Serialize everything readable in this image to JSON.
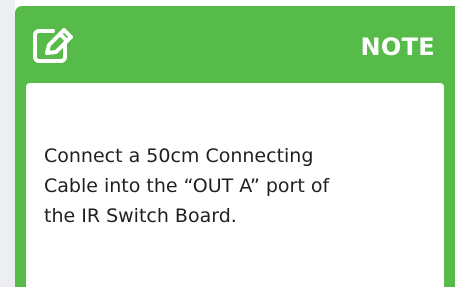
{
  "note": {
    "title": "NOTE",
    "icon": "edit-note-icon",
    "text": "Connect a 50cm Connecting\nCable into the “OUT A” port of\nthe IR Switch Board."
  },
  "colors": {
    "accent": "#56bb48",
    "panel": "#ffffff",
    "text": "#1f1f1f",
    "side_strip": "#eceef1"
  }
}
